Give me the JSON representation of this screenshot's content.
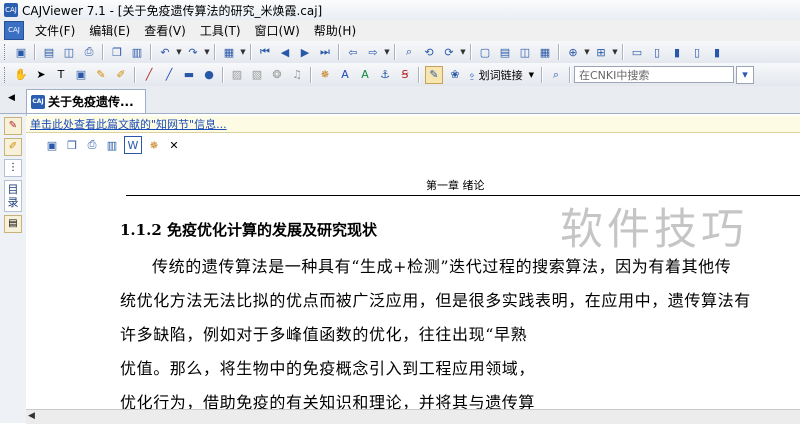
{
  "window": {
    "title": "CAJViewer 7.1 - [关于免疫遗传算法的研究_米焕霞.caj]",
    "app_icon_text": "CAJ"
  },
  "menu": [
    "文件(F)",
    "编辑(E)",
    "查看(V)",
    "工具(T)",
    "窗口(W)",
    "帮助(H)"
  ],
  "toolbar2": {
    "link_label": "划词链接",
    "search_placeholder": "在CNKI中搜索"
  },
  "tab": {
    "label": "关于免疫遗传..."
  },
  "left_pane": {
    "toc_label": "目录"
  },
  "infobar": "单击此处查看此篇文献的\"知网节\"信息...",
  "document": {
    "chapter": "第一章  绪论",
    "section": "1.1.2  免疫优化计算的发展及研究现状",
    "lines": [
      "传统的遗传算法是一种具有“生成+检测”迭代过程的搜索算法，因为有着其他传",
      "统优化方法无法比拟的优点而被广泛应用，但是很多实践表明，在应用中，遗传算法有",
      "许多缺陷，例如对于多峰值函数的优化，往往出现“早熟",
      "优值。那么，将生物中的免疫概念引入到工程应用领域，",
      "优化行为，借助免疫的有关知识和理论，并将其与遗传算"
    ]
  },
  "watermark": "软件技巧"
}
